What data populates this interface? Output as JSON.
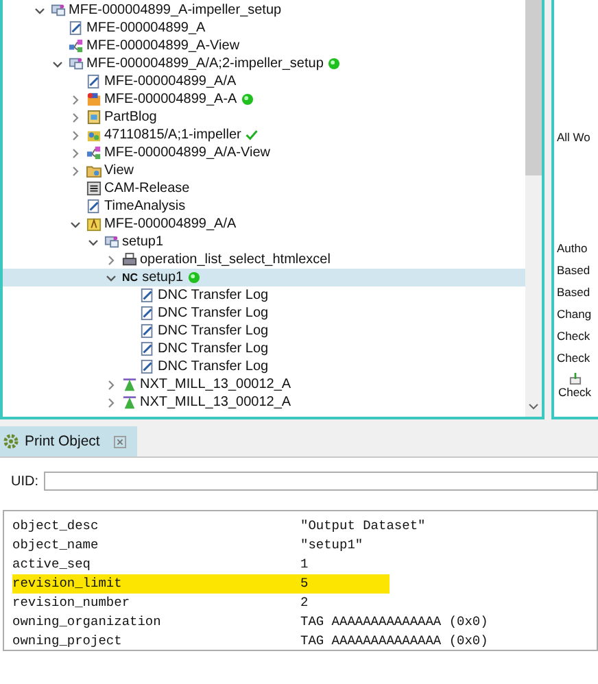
{
  "tree": {
    "items": [
      {
        "label": "MFE-000004899_A-impeller_setup",
        "kind": "setup",
        "expanded": true,
        "selected": false,
        "online": false,
        "released": false,
        "children": [
          {
            "label": "MFE-000004899_A",
            "kind": "dataset",
            "selected": false,
            "online": false,
            "released": false
          },
          {
            "label": "MFE-000004899_A-View",
            "kind": "view",
            "selected": false,
            "online": false,
            "released": false
          },
          {
            "label": "MFE-000004899_A/A;2-impeller_setup",
            "kind": "setup",
            "expanded": true,
            "selected": false,
            "online": true,
            "released": false,
            "children": [
              {
                "label": "MFE-000004899_A/A",
                "kind": "dataset",
                "selected": false,
                "online": false,
                "released": false
              },
              {
                "label": "MFE-000004899_A-A",
                "kind": "item",
                "expanded": false,
                "selected": false,
                "online": true,
                "released": false
              },
              {
                "label": "PartBlog",
                "kind": "blog",
                "expanded": false,
                "selected": false,
                "online": false,
                "released": false
              },
              {
                "label": "47110815/A;1-impeller",
                "kind": "assembly",
                "expanded": false,
                "selected": false,
                "online": false,
                "released": true
              },
              {
                "label": "MFE-000004899_A/A-View",
                "kind": "view",
                "expanded": false,
                "selected": false,
                "online": false,
                "released": false
              },
              {
                "label": "View",
                "kind": "folder",
                "expanded": false,
                "selected": false,
                "online": false,
                "released": false
              },
              {
                "label": "CAM-Release",
                "kind": "release",
                "selected": false,
                "online": false,
                "released": false
              },
              {
                "label": "TimeAnalysis",
                "kind": "dataset",
                "selected": false,
                "online": false,
                "released": false
              },
              {
                "label": "MFE-000004899_A/A",
                "kind": "revision",
                "expanded": true,
                "selected": false,
                "online": false,
                "released": false,
                "children": [
                  {
                    "label": "setup1",
                    "kind": "setup",
                    "expanded": true,
                    "selected": false,
                    "online": false,
                    "released": false,
                    "children": [
                      {
                        "label": "operation_list_select_htmlexcel",
                        "kind": "printer",
                        "expanded": false,
                        "selected": false,
                        "online": false,
                        "released": false
                      },
                      {
                        "label": "setup1",
                        "kind": "nc",
                        "badge": "NC",
                        "expanded": true,
                        "selected": true,
                        "online": true,
                        "released": false,
                        "children": [
                          {
                            "label": "DNC Transfer Log",
                            "kind": "dataset",
                            "selected": false,
                            "online": false,
                            "released": false
                          },
                          {
                            "label": "DNC Transfer Log",
                            "kind": "dataset",
                            "selected": false,
                            "online": false,
                            "released": false
                          },
                          {
                            "label": "DNC Transfer Log",
                            "kind": "dataset",
                            "selected": false,
                            "online": false,
                            "released": false
                          },
                          {
                            "label": "DNC Transfer Log",
                            "kind": "dataset",
                            "selected": false,
                            "online": false,
                            "released": false
                          },
                          {
                            "label": "DNC Transfer Log",
                            "kind": "dataset",
                            "selected": false,
                            "online": false,
                            "released": false
                          }
                        ]
                      },
                      {
                        "label": "NXT_MILL_13_00012_A",
                        "kind": "machine",
                        "expanded": false,
                        "selected": false,
                        "online": false,
                        "released": false
                      },
                      {
                        "label": "NXT_MILL_13_00012_A",
                        "kind": "machine",
                        "expanded": false,
                        "selected": false,
                        "online": false,
                        "released": false
                      }
                    ]
                  }
                ]
              }
            ]
          }
        ]
      }
    ]
  },
  "right_panel": {
    "labels": [
      "All Wo",
      "Autho",
      "Based",
      "Based",
      "Chang",
      "Check",
      "Check"
    ],
    "button": "Check"
  },
  "print_object": {
    "tab": {
      "label": "Print Object",
      "selected": true
    },
    "uid_label": "UID:",
    "properties": [
      {
        "name": "object_desc",
        "value": "\"Output Dataset\"",
        "highlighted": false
      },
      {
        "name": "object_name",
        "value": "\"setup1\"",
        "highlighted": false
      },
      {
        "name": "active_seq",
        "value": "1",
        "highlighted": false
      },
      {
        "name": "revision_limit",
        "value": "5",
        "highlighted": true
      },
      {
        "name": "revision_number",
        "value": "2",
        "highlighted": false
      },
      {
        "name": "owning_organization",
        "value": "TAG AAAAAAAAAAAAAA (0x0)",
        "highlighted": false
      },
      {
        "name": "owning_project",
        "value": "TAG AAAAAAAAAAAAAA (0x0)",
        "highlighted": false
      }
    ]
  }
}
